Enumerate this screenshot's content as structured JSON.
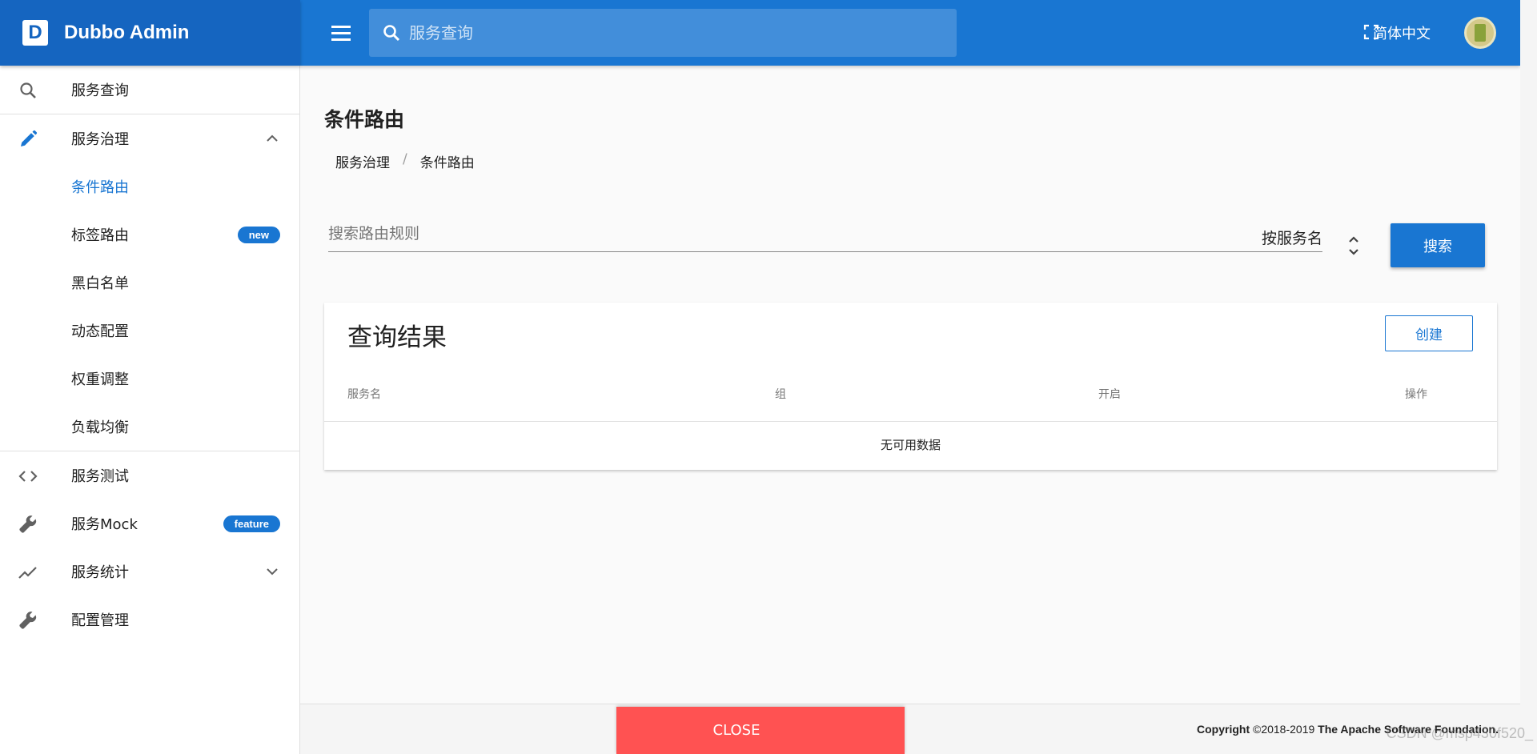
{
  "brand": {
    "logo_letter": "D",
    "title": "Dubbo Admin"
  },
  "topbar": {
    "search_placeholder": "服务查询",
    "language": "简体中文"
  },
  "sidebar": {
    "items": [
      {
        "label": "服务查询",
        "icon": "search-icon"
      },
      {
        "label": "服务治理",
        "icon": "pencil-icon",
        "expanded": true
      },
      {
        "label": "条件路由",
        "active": true
      },
      {
        "label": "标签路由",
        "badge": "new"
      },
      {
        "label": "黑白名单"
      },
      {
        "label": "动态配置"
      },
      {
        "label": "权重调整"
      },
      {
        "label": "负载均衡"
      },
      {
        "label": "服务测试",
        "icon": "code-icon"
      },
      {
        "label": "服务Mock",
        "icon": "wrench-icon",
        "badge": "feature"
      },
      {
        "label": "服务统计",
        "icon": "trending-icon",
        "expanded": false
      },
      {
        "label": "配置管理",
        "icon": "wrench-icon"
      }
    ]
  },
  "main": {
    "title": "条件路由",
    "breadcrumb": [
      "服务治理",
      "/",
      "条件路由"
    ],
    "filter": {
      "placeholder": "搜索路由规则",
      "select_value": "按服务名"
    },
    "search_button": "搜索",
    "results": {
      "title": "查询结果",
      "create_button": "创建",
      "columns": [
        "服务名",
        "组",
        "开启",
        "操作"
      ],
      "empty_text": "无可用数据"
    }
  },
  "footer": {
    "copyright_label": "Copyright",
    "copyright_years": "©2018-2019",
    "copyright_owner": "The Apache Software Foundation."
  },
  "close_button": "CLOSE",
  "watermark": "CSDN @msp430f520_",
  "colors": {
    "primary": "#1976d2",
    "brand_dark": "#1565c0",
    "close_red": "#ff5252"
  }
}
